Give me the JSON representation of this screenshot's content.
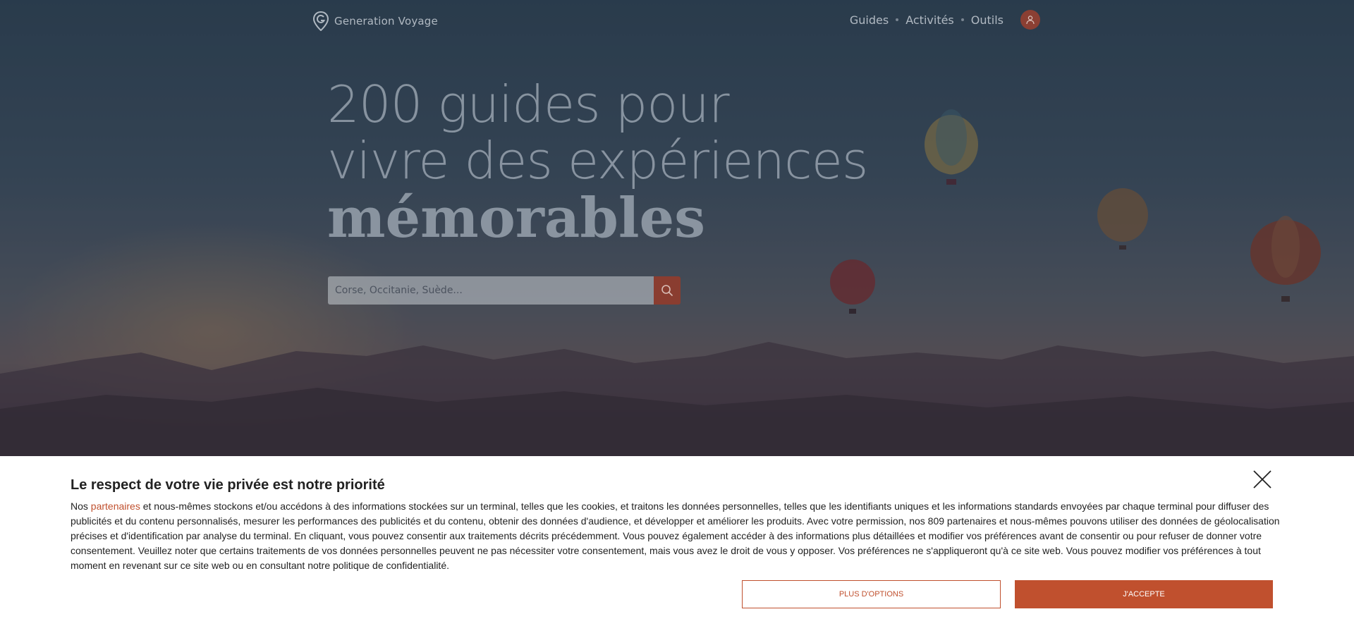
{
  "header": {
    "logo_text": "Generation Voyage",
    "nav": [
      {
        "label": "Guides"
      },
      {
        "label": "Activités"
      },
      {
        "label": "Outils"
      }
    ],
    "logo_icon": "location-pin-g-icon",
    "account_icon": "user-icon"
  },
  "hero": {
    "headline_line1": "200 guides pour",
    "headline_line2": "vivre des expériences",
    "headline_bold": "mémorables",
    "search_placeholder": "Corse, Occitanie, Suède...",
    "search_icon": "search-icon"
  },
  "cookie_banner": {
    "title": "Le respect de votre vie privée est notre priorité",
    "text_prefix": "Nos ",
    "partners_link": "partenaires",
    "text_body": " et nous-mêmes stockons et/ou accédons à des informations stockées sur un terminal, telles que les cookies, et traitons les données personnelles, telles que les identifiants uniques et les informations standards envoyées par chaque terminal pour diffuser des publicités et du contenu personnalisés, mesurer les performances des publicités et du contenu, obtenir des données d'audience, et développer et améliorer les produits. Avec votre permission, nos 809 partenaires et nous-mêmes pouvons utiliser des données de géolocalisation précises et d'identification par analyse du terminal. En cliquant, vous pouvez consentir aux traitements décrits précédemment. Vous pouvez également accéder à des informations plus détaillées et modifier vos préférences avant de consentir ou pour refuser de donner votre consentement. Veuillez noter que certains traitements de vos données personnelles peuvent ne pas nécessiter votre consentement, mais vous avez le droit de vous y opposer. Vos préférences ne s'appliqueront qu'à ce site web. Vous pouvez modifier vos préférences à tout moment en revenant sur ce site web ou en consultant notre politique de confidentialité.",
    "options_label": "PLUS D'OPTIONS",
    "accept_label": "J'ACCEPTE",
    "close_icon": "close-icon"
  },
  "colors": {
    "accent": "#c0502e",
    "accent_dark": "#8a3d30"
  }
}
